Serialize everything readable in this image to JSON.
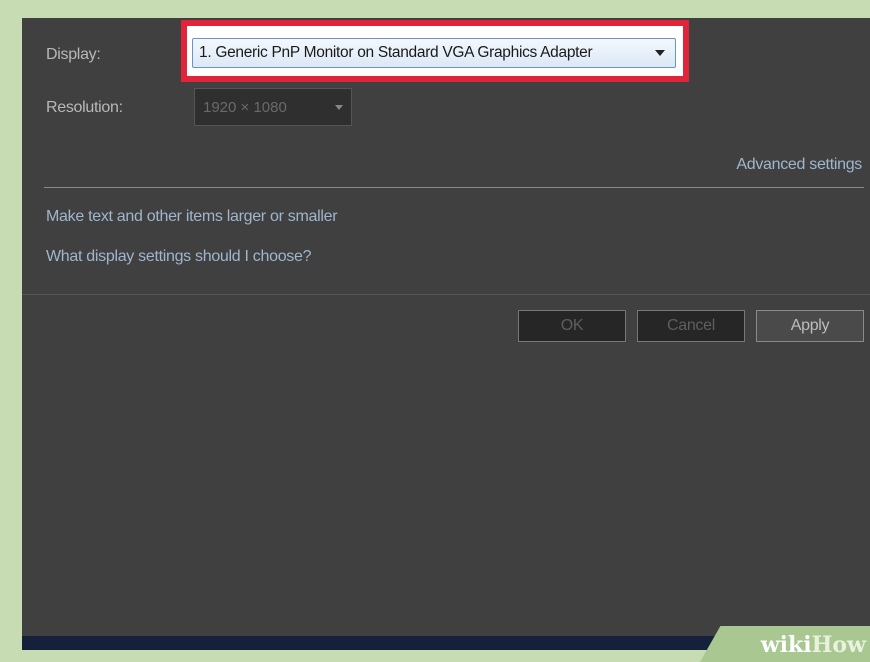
{
  "display": {
    "label": "Display:",
    "selected": "1. Generic PnP Monitor on Standard VGA Graphics Adapter"
  },
  "resolution": {
    "label": "Resolution:",
    "selected": "1920 × 1080"
  },
  "links": {
    "advanced": "Advanced settings",
    "text_size": "Make text and other items larger or smaller",
    "help": "What display settings should I choose?"
  },
  "buttons": {
    "ok": "OK",
    "cancel": "Cancel",
    "apply": "Apply"
  },
  "watermark": {
    "wiki": "wiki",
    "how": "How"
  },
  "colors": {
    "highlight": "#e0243a",
    "panel": "#404040",
    "link": "#9fb6cc"
  }
}
